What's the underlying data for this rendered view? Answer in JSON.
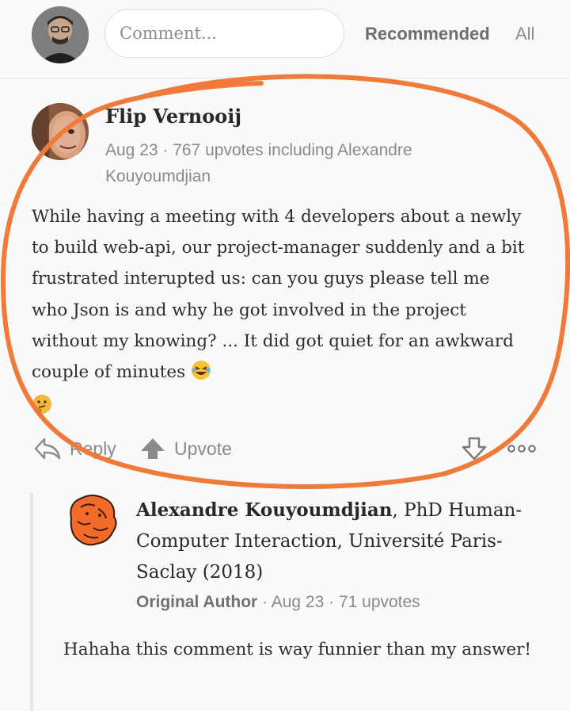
{
  "header": {
    "comment_placeholder": "Comment...",
    "sort_tabs": [
      "Recommended",
      "All"
    ]
  },
  "comment": {
    "author": "Flip Vernooij",
    "meta": "Aug 23 · 767 upvotes including Alexandre Kouyoumdjian",
    "body": "While having a meeting with 4 developers about a newly to build web-api, our project-manager suddenly and a bit frustrated interupted us: can you guys please tell me who Json is and why he got involved in the project without my knowing? ... It did got quiet for an awkward couple of minutes",
    "emojis": [
      "laughing-emoji",
      "thinking-emoji"
    ],
    "actions": {
      "reply_label": "Reply",
      "upvote_label": "Upvote"
    }
  },
  "reply": {
    "author": "Alexandre Kouyoumdjian",
    "credential": ", PhD Human-Computer Interaction, Université Paris-Saclay (2018)",
    "original_author_label": "Original Author",
    "meta": " · Aug 23 · 71 upvotes",
    "body": "Hahaha this comment is way funnier than my answer!"
  },
  "colors": {
    "annotation_circle": "#f07a3a",
    "reply_avatar": "#f26b2c",
    "muted_text": "#8a8a8a"
  }
}
